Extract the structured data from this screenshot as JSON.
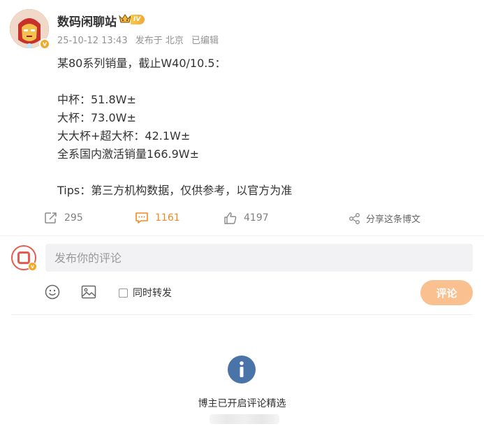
{
  "post": {
    "username": "数码闲聊站",
    "level_badge": "IV",
    "verified_mark": "v",
    "meta": {
      "time": "25-10-12 13:43",
      "location": "发布于 北京",
      "edited": "已编辑"
    },
    "lines": [
      "某80系列销量，截止W40/10.5：",
      "",
      "中杯：51.8W±",
      "大杯：73.0W±",
      "大大杯+超大杯：42.1W±",
      "全系国内激活销量166.9W±",
      "",
      "Tips：第三方机构数据，仅供参考，以官方为准"
    ]
  },
  "actions": {
    "repost_count": "295",
    "comment_count": "1161",
    "like_count": "4197",
    "share_label": "分享这条博文"
  },
  "comment_box": {
    "placeholder": "发布你的评论",
    "value": "",
    "repost_label": "同时转发",
    "submit_label": "评论"
  },
  "notice": {
    "text": "博主已开启评论精选"
  },
  "icons": {
    "repost": "repost-icon",
    "comment": "comment-icon",
    "like": "thumbs-up-icon",
    "share": "share-icon",
    "emoji": "emoji-icon",
    "image": "image-icon",
    "info": "info-icon",
    "crown": "crown-icon"
  },
  "colors": {
    "accent_orange": "#f08a24",
    "submit_bg": "#fbc08f",
    "info_blue": "#4a73a8"
  }
}
